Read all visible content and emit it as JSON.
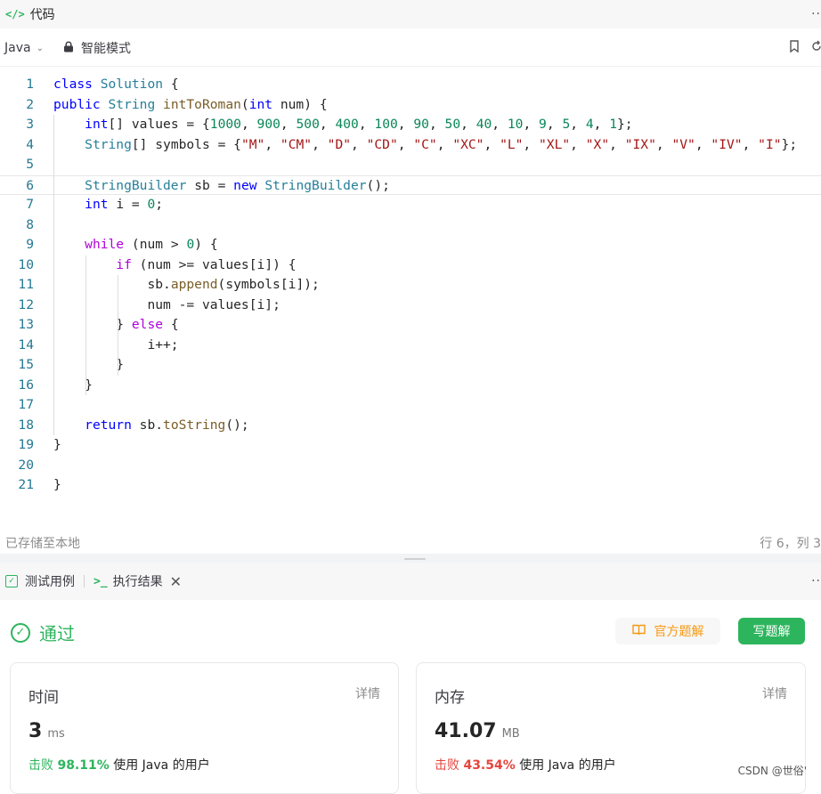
{
  "header": {
    "tab_icon": "</>",
    "tab_label": "代码",
    "more": "··"
  },
  "toolbar": {
    "language": "Java",
    "mode": "智能模式"
  },
  "editor": {
    "lines": [
      {
        "n": "1"
      },
      {
        "n": "2"
      },
      {
        "n": "3"
      },
      {
        "n": "4"
      },
      {
        "n": "5"
      },
      {
        "n": "6"
      },
      {
        "n": "7"
      },
      {
        "n": "8"
      },
      {
        "n": "9"
      },
      {
        "n": "10"
      },
      {
        "n": "11"
      },
      {
        "n": "12"
      },
      {
        "n": "13"
      },
      {
        "n": "14"
      },
      {
        "n": "15"
      },
      {
        "n": "16"
      },
      {
        "n": "17"
      },
      {
        "n": "18"
      },
      {
        "n": "19"
      },
      {
        "n": "20"
      },
      {
        "n": "21"
      }
    ],
    "code": [
      "class Solution {",
      "public String intToRoman(int num) {",
      "    int[] values = {1000, 900, 500, 400, 100, 90, 50, 40, 10, 9, 5, 4, 1};",
      "    String[] symbols = {\"M\", \"CM\", \"D\", \"CD\", \"C\", \"XC\", \"L\", \"XL\", \"X\", \"IX\", \"V\", \"IV\", \"I\"};",
      "",
      "    StringBuilder sb = new StringBuilder();",
      "    int i = 0;",
      "",
      "    while (num > 0) {",
      "        if (num >= values[i]) {",
      "            sb.append(symbols[i]);",
      "            num -= values[i];",
      "        } else {",
      "            i++;",
      "        }",
      "    }",
      "",
      "    return sb.toString();",
      "}",
      "",
      "}"
    ],
    "current_line": 6
  },
  "status": {
    "saved": "已存储至本地",
    "position": "行 6，列 3"
  },
  "bottom_tabs": {
    "testcase": "测试用例",
    "result": "执行结果",
    "more": "··"
  },
  "result": {
    "status": "通过",
    "official_solution": "官方题解",
    "write_solution": "写题解",
    "time": {
      "title": "时间",
      "detail": "详情",
      "value": "3",
      "unit": "ms",
      "beat_label": "击败",
      "beat_pct": "98.11%",
      "suffix": "使用 Java 的用户"
    },
    "memory": {
      "title": "内存",
      "detail": "详情",
      "value": "41.07",
      "unit": "MB",
      "beat_label": "击败",
      "beat_pct": "43.54%",
      "suffix": "使用 Java 的用户"
    }
  },
  "watermark": "CSDN @世俗'",
  "colors": {
    "accent": "#2db55d",
    "warning": "#f59a12",
    "danger": "#e5453d"
  }
}
